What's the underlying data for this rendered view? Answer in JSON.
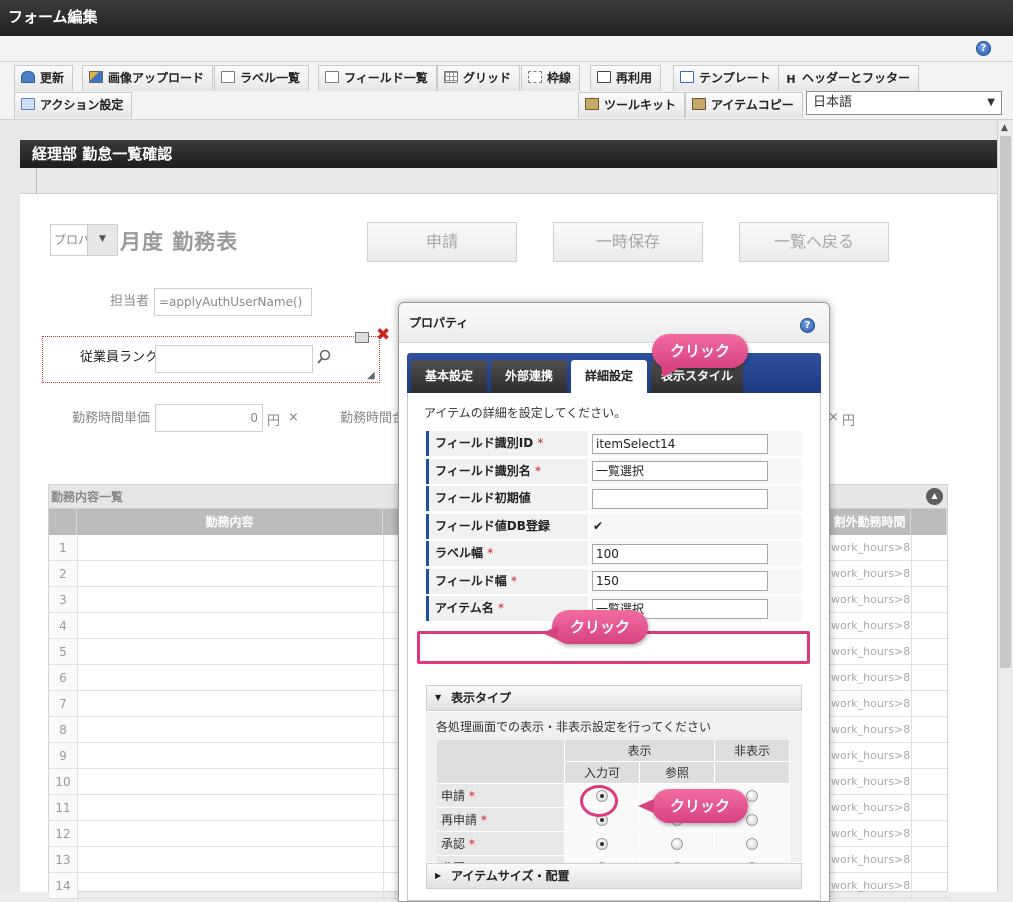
{
  "window": {
    "title": "フォーム編集"
  },
  "toolbar": {
    "row1": [
      "更新",
      "画像アップロード",
      "ラベル一覧",
      "フィールド一覧",
      "グリッド",
      "枠線",
      "再利用",
      "テンプレート",
      "ヘッダーとフッター"
    ],
    "row2_left": "アクション設定",
    "row2_right": [
      "ツールキット",
      "アイテムコピー"
    ],
    "language": "日本語"
  },
  "form": {
    "header": "経理部 勤怠一覧確認",
    "title_select": "プロパ",
    "title": "月度 勤務表",
    "buttons": {
      "apply": "申請",
      "save": "一時保存",
      "back": "一覧へ戻る"
    },
    "assignee_label": "担当者",
    "assignee_value": "=applyAuthUserName()",
    "rank_label": "従業員ランク",
    "unit_label": "勤務時間単価",
    "unit_value": "0",
    "unit_suffix": "円",
    "unit_mult": "×",
    "hours_label": "勤務時間合",
    "right_suffix": "円",
    "right_value": "×"
  },
  "grid": {
    "title": "勤務内容一覧",
    "col_main": "勤務内容",
    "col_overtime": "割外勤務時間",
    "rows": [
      "1",
      "2",
      "3",
      "4",
      "5",
      "6",
      "7",
      "8",
      "9",
      "10",
      "11",
      "12",
      "13",
      "14"
    ],
    "expr": "work_hours>8,"
  },
  "dialog": {
    "title": "プロパティ",
    "tabs": [
      "基本設定",
      "外部連携",
      "詳細設定",
      "表示スタイル"
    ],
    "description": "アイテムの詳細を設定してください。",
    "properties": [
      {
        "label": "フィールド識別ID",
        "required": "*",
        "value": "itemSelect14"
      },
      {
        "label": "フィールド識別名",
        "required": "*",
        "value": "一覧選択"
      },
      {
        "label": "フィールド初期値",
        "required": "",
        "value": ""
      },
      {
        "label": "フィールド値DB登録",
        "required": "",
        "value": "✔"
      },
      {
        "label": "ラベル幅",
        "required": "*",
        "value": "100"
      },
      {
        "label": "フィールド幅",
        "required": "*",
        "value": "150"
      },
      {
        "label": "アイテム名",
        "required": "*",
        "value": "一覧選択"
      }
    ],
    "display_type": {
      "header": "表示タイプ",
      "description": "各処理画面での表示・非表示設定を行ってください",
      "col_show": "表示",
      "col_hide": "非表示",
      "col_input": "入力可",
      "col_ref": "参照",
      "rows": [
        {
          "label": "申請",
          "req": "*"
        },
        {
          "label": "再申請",
          "req": "*"
        },
        {
          "label": "承認",
          "req": "*"
        },
        {
          "label": "参照",
          "req": "*"
        }
      ]
    },
    "size_section": "アイテムサイズ・配置"
  },
  "annotations": {
    "click": "クリック"
  },
  "colors": {
    "accent": "#e0387f",
    "tab_bar": "#1e3a82",
    "header_dark": "#1e1e1e"
  }
}
